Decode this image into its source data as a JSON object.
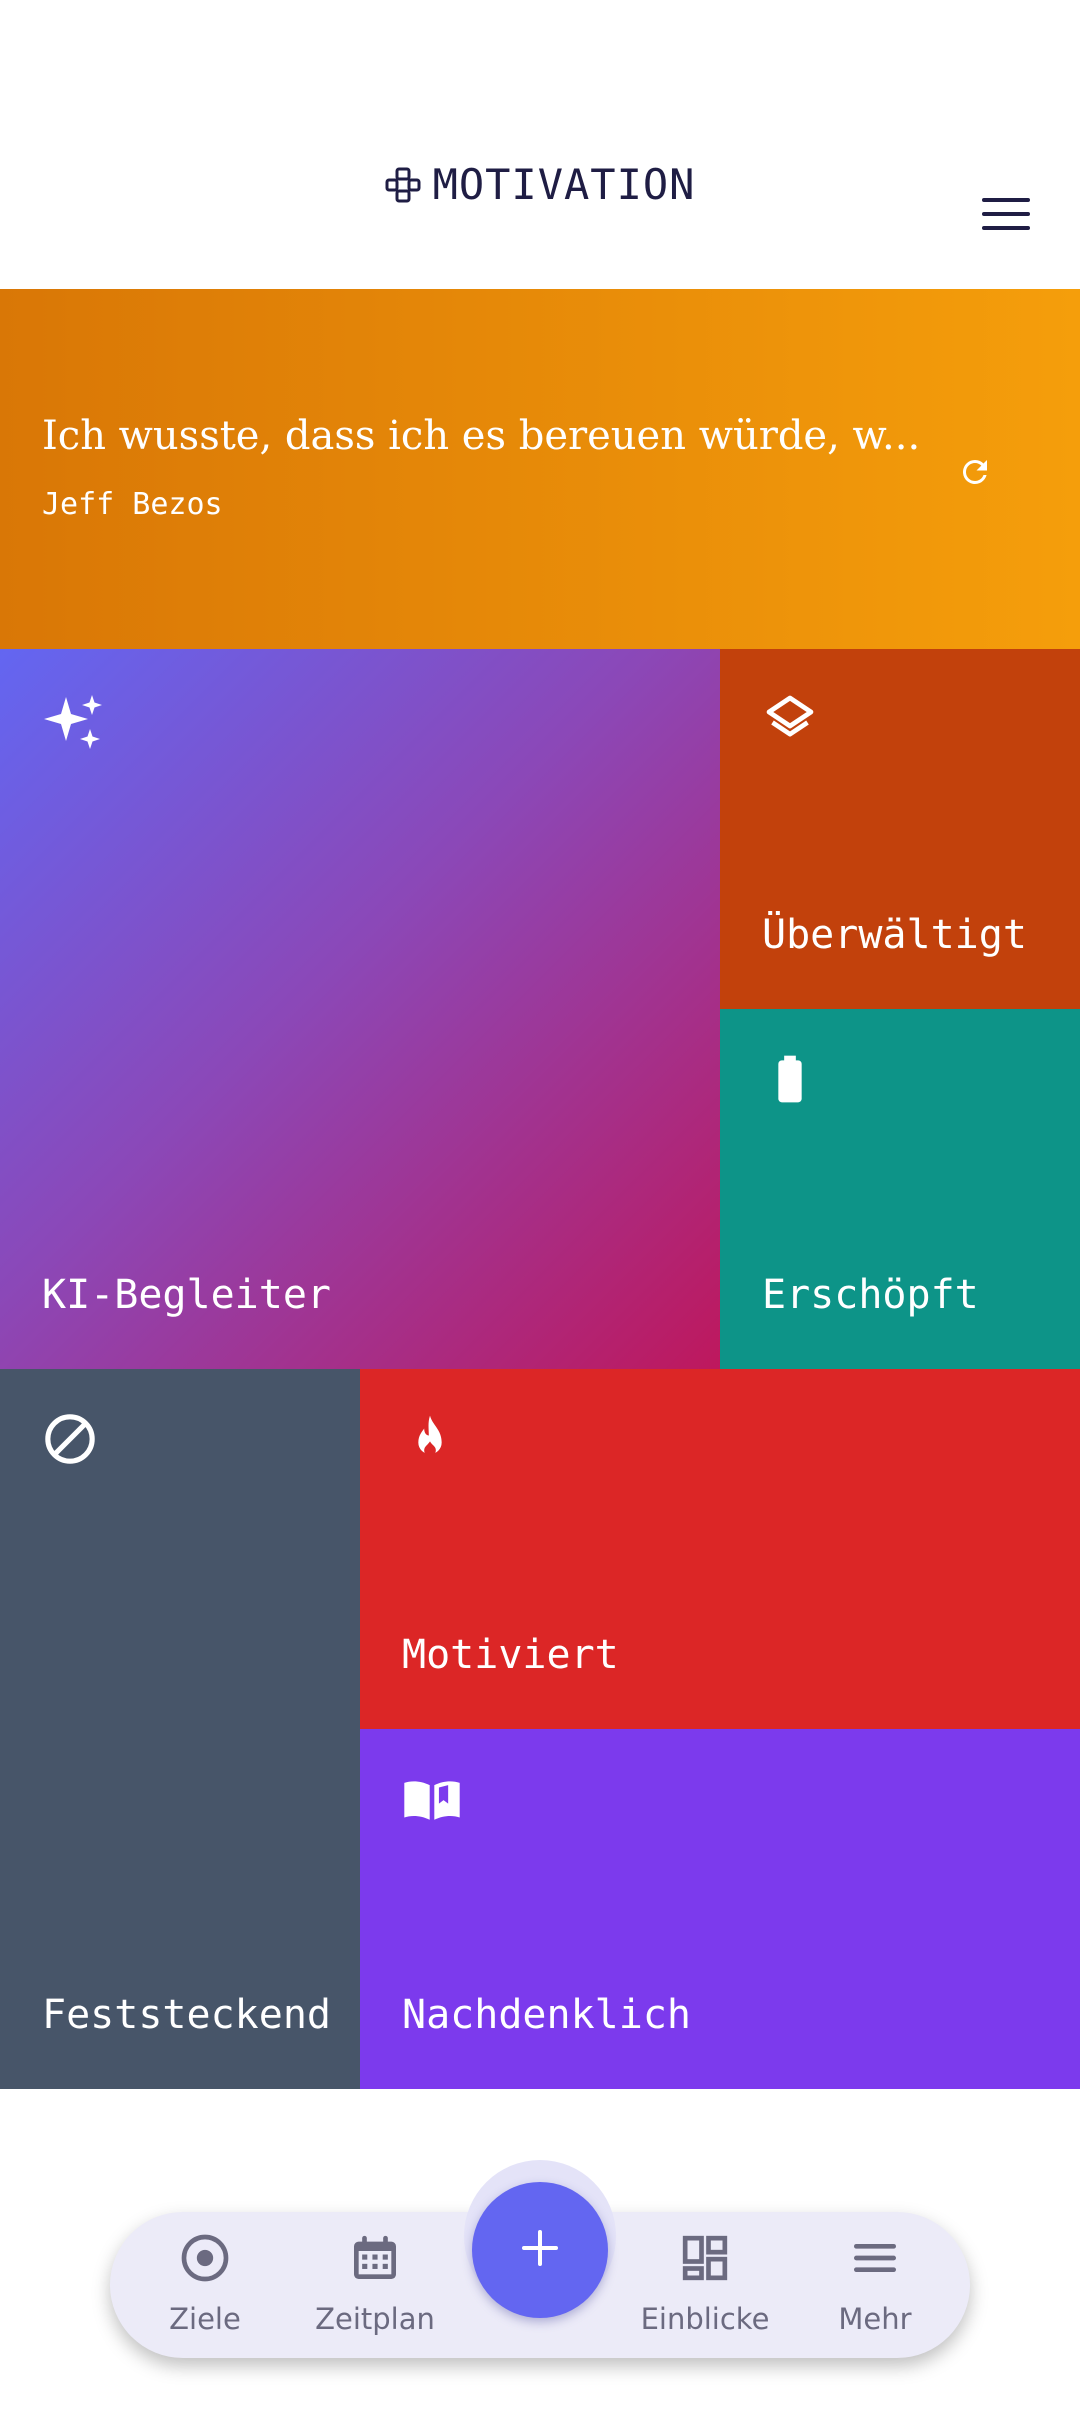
{
  "header": {
    "title": "MOTIVATION",
    "brand_icon": "gamepad-icon",
    "menu_icon": "hamburger-menu-icon"
  },
  "quote": {
    "text": "Ich wusste, dass ich es bereuen würde, w...",
    "author": "Jeff Bezos",
    "refresh_icon": "refresh-icon"
  },
  "tiles": [
    {
      "label": "KI-Begleiter",
      "icon": "sparkles-icon",
      "color": "#6366f1"
    },
    {
      "label": "Überwältigt",
      "icon": "layers-icon",
      "color": "#c2410c"
    },
    {
      "label": "Erschöpft",
      "icon": "battery-icon",
      "color": "#0d9488"
    },
    {
      "label": "Feststeckend",
      "icon": "blocked-icon",
      "color": "#475569"
    },
    {
      "label": "Motiviert",
      "icon": "flame-icon",
      "color": "#dc2626"
    },
    {
      "label": "Nachdenklich",
      "icon": "open-book-icon",
      "color": "#7c3aed"
    }
  ],
  "nav": {
    "items": [
      {
        "label": "Ziele",
        "icon": "target-icon"
      },
      {
        "label": "Zeitplan",
        "icon": "calendar-icon"
      },
      {
        "label": "Einblicke",
        "icon": "dashboard-icon"
      },
      {
        "label": "Mehr",
        "icon": "menu-icon"
      }
    ],
    "fab_icon": "plus-icon",
    "fab_color": "#6366f1"
  },
  "theme": {
    "quote_gradient_start": "#d97706",
    "quote_gradient_end": "#f59e0b",
    "title_color": "#1f1d44"
  }
}
